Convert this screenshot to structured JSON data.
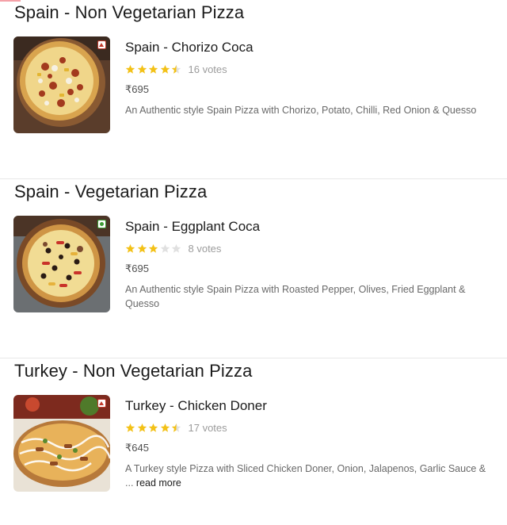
{
  "sections": [
    {
      "title": "Spain - Non Vegetarian Pizza",
      "dish": {
        "name": "Spain - Chorizo Coca",
        "type_icon": "non-veg-icon",
        "rating": 4.5,
        "votes": "16 votes",
        "price": "₹695",
        "description": "An Authentic style Spain Pizza with Chorizo, Potato, Chilli, Red Onion & Quesso",
        "read_more": ""
      }
    },
    {
      "title": "Spain - Vegetarian Pizza",
      "dish": {
        "name": "Spain - Eggplant Coca",
        "type_icon": "veg-icon",
        "rating": 3,
        "votes": "8 votes",
        "price": "₹695",
        "description": "An Authentic style Spain Pizza with Roasted Pepper, Olives, Fried Eggplant & Quesso",
        "read_more": ""
      }
    },
    {
      "title": "Turkey - Non Vegetarian Pizza",
      "dish": {
        "name": "Turkey - Chicken Doner",
        "type_icon": "non-veg-icon",
        "rating": 4.5,
        "votes": "17 votes",
        "price": "₹645",
        "description": "A Turkey style Pizza with Sliced Chicken Doner, Onion, Jalapenos, Garlic Sauce & ... ",
        "read_more": "read more"
      }
    }
  ],
  "colors": {
    "star_filled": "#f3c117",
    "star_empty": "#e0e0e0",
    "non_veg": "#c0392b",
    "veg": "#3d9b35",
    "accent": "#f5a1a8"
  }
}
